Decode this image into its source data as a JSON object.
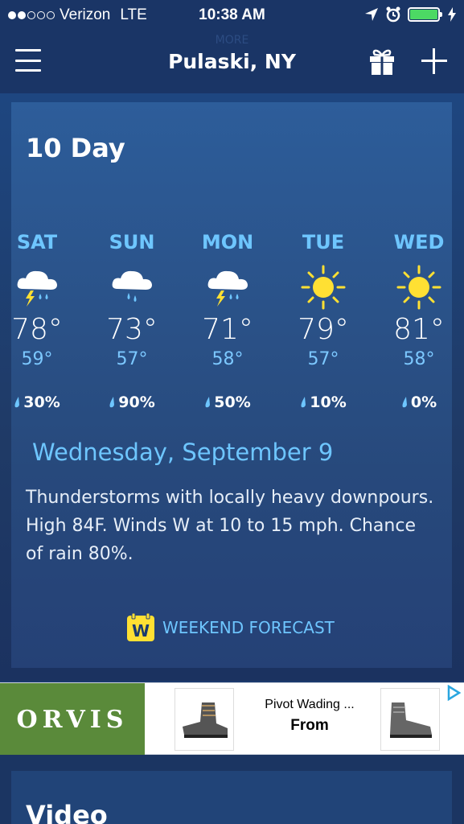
{
  "status": {
    "carrier": "Verizon",
    "network": "LTE",
    "time": "10:38 AM"
  },
  "nav": {
    "title": "Pulaski, NY",
    "more_label": "MORE"
  },
  "forecast": {
    "title": "10 Day",
    "days": [
      {
        "name": "SAT",
        "high": "78°",
        "low": "59°",
        "precip": "30%",
        "icon": "thunderstorm-icon"
      },
      {
        "name": "SUN",
        "high": "73°",
        "low": "57°",
        "precip": "90%",
        "icon": "rain-icon"
      },
      {
        "name": "MON",
        "high": "71°",
        "low": "58°",
        "precip": "50%",
        "icon": "thunderstorm-icon"
      },
      {
        "name": "TUE",
        "high": "79°",
        "low": "57°",
        "precip": "10%",
        "icon": "sun-icon"
      },
      {
        "name": "WED",
        "high": "81°",
        "low": "58°",
        "precip": "0%",
        "icon": "sun-icon"
      }
    ],
    "detail_date": "Wednesday, September 9",
    "detail_text": "Thunderstorms with locally heavy downpours. High 84F. Winds W at 10 to 15 mph. Chance of rain 80%.",
    "weekend_label": "WEEKEND FORECAST",
    "weekend_badge": "W"
  },
  "ad": {
    "brand": "ORVIS",
    "product_text": "Pivot Wading ...",
    "product_sub": "From"
  },
  "video": {
    "title": "Video"
  },
  "colors": {
    "accent": "#6ec6ff",
    "sun": "#ffe033",
    "battery": "#4cd964"
  }
}
